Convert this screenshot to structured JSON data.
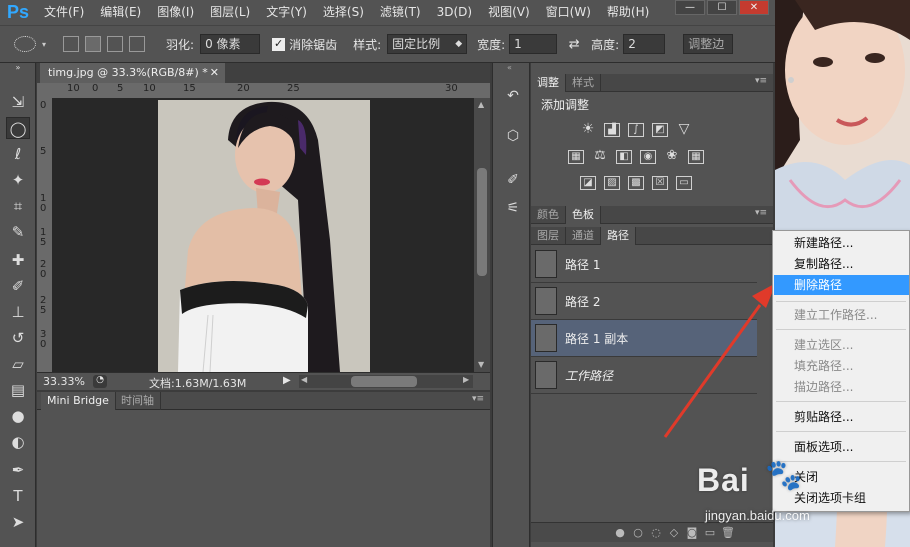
{
  "app": {
    "logo": "Ps",
    "accent": "#31a8ff"
  },
  "menu": [
    "文件(F)",
    "编辑(E)",
    "图像(I)",
    "图层(L)",
    "文字(Y)",
    "选择(S)",
    "滤镜(T)",
    "3D(D)",
    "视图(V)",
    "窗口(W)",
    "帮助(H)"
  ],
  "options": {
    "feather_label": "羽化:",
    "feather_value": "0 像素",
    "antialias_label": "消除锯齿",
    "style_label": "样式:",
    "style_value": "固定比例",
    "width_label": "宽度:",
    "width_value": "1",
    "height_label": "高度:",
    "height_value": "2",
    "refine_edge": "调整边"
  },
  "document": {
    "tab_title": "timg.jpg @ 33.3%(RGB/8#) *",
    "zoom": "33.33%",
    "doc_info": "文档:1.63M/1.63M",
    "ruler_h": [
      "10",
      "0",
      "5",
      "10",
      "15",
      "20",
      "25",
      "30"
    ],
    "ruler_v": [
      "0",
      "5",
      "1 0",
      "1 5",
      "2 0",
      "2 5",
      "3 0",
      "3 5"
    ]
  },
  "bottom_panel": {
    "tabs": [
      "Mini Bridge",
      "时间轴"
    ]
  },
  "adjustments": {
    "tabs": [
      "调整",
      "样式"
    ],
    "heading": "添加调整"
  },
  "color_panel": {
    "tabs": [
      "颜色",
      "色板"
    ]
  },
  "paths_panel": {
    "tabs": [
      "图层",
      "通道",
      "路径"
    ],
    "rows": [
      {
        "name": "路径 1",
        "selected": false
      },
      {
        "name": "路径 2",
        "selected": false
      },
      {
        "name": "路径 1 副本",
        "selected": true
      },
      {
        "name": "工作路径",
        "selected": false
      }
    ]
  },
  "context_menu": {
    "items": [
      {
        "label": "新建路径...",
        "state": "normal"
      },
      {
        "label": "复制路径...",
        "state": "normal"
      },
      {
        "label": "删除路径",
        "state": "highlighted"
      },
      {
        "label": "建立工作路径...",
        "state": "disabled"
      },
      {
        "label": "建立选区...",
        "state": "disabled"
      },
      {
        "label": "填充路径...",
        "state": "disabled"
      },
      {
        "label": "描边路径...",
        "state": "disabled"
      },
      {
        "label": "剪贴路径...",
        "state": "normal"
      },
      {
        "label": "面板选项...",
        "state": "normal"
      },
      {
        "label": "关闭",
        "state": "normal"
      },
      {
        "label": "关闭选项卡组",
        "state": "normal"
      }
    ],
    "highlight_color": "#3399ff"
  },
  "watermark": {
    "brand": "Bai",
    "site": "jingyan.baidu.com"
  }
}
